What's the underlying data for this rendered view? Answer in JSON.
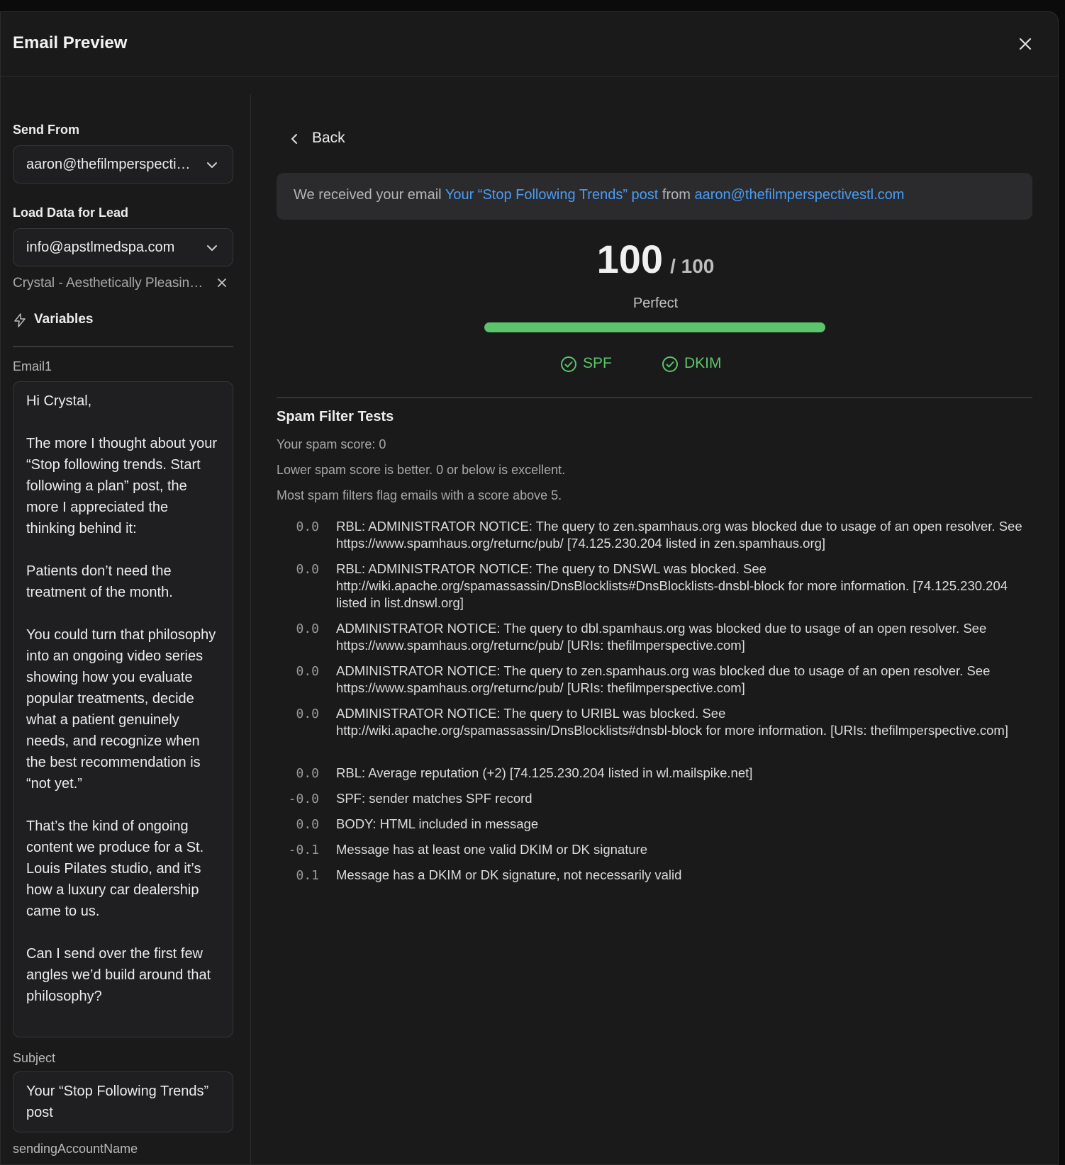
{
  "modal": {
    "title": "Email Preview"
  },
  "left": {
    "send_from_label": "Send From",
    "send_from_value": "aaron@thefilmperspectivestl.com",
    "load_data_label": "Load Data for Lead",
    "lead_email": "info@apstlmedspa.com",
    "lead_name": "Crystal - Aesthetically Pleasing Med Spa",
    "variables_tab": "Variables",
    "email1_label": "Email1",
    "email1_text": "Hi Crystal,\n\nThe more I thought about your “Stop following trends. Start following a plan” post, the more I appreciated the thinking behind it:\n\nPatients don’t need the treatment of the month.\n\nYou could turn that philosophy into an ongoing video series showing how you evaluate popular treatments, decide what a patient genuinely needs, and recognize when the best recommendation is “not yet.”\n\nThat’s the kind of ongoing content we produce for a St. Louis Pilates studio, and it’s how a luxury car dealership came to us.\n\nCan I send over the first few angles we’d build around that philosophy?",
    "subject_label": "Subject",
    "subject_value": "Your “Stop Following Trends” post",
    "sending_account_label": "sendingAccountName"
  },
  "right": {
    "back_label": "Back",
    "receipt_prefix": "We received your email",
    "receipt_subject": "Your “Stop Following Trends” post",
    "receipt_from_word": "from",
    "receipt_sender": "aaron@thefilmperspectivestl.com",
    "score": "100",
    "score_out_of": "/ 100",
    "score_fraction": 1.0,
    "score_label": "Perfect",
    "auth_spf": "SPF",
    "auth_dkim": "DKIM",
    "section_title": "Spam Filter Tests",
    "info_lines": [
      "Your spam score: 0",
      "Lower spam score is better. 0 or below is excellent.",
      "Most spam filters flag emails with a score above 5."
    ],
    "tests": [
      {
        "score": "0.0",
        "desc": "RBL: ADMINISTRATOR NOTICE: The query to zen.spamhaus.org was blocked due to usage of an open resolver. See https://www.spamhaus.org/returnc/pub/ [74.125.230.204 listed in zen.spamhaus.org]"
      },
      {
        "score": "0.0",
        "desc": "RBL: ADMINISTRATOR NOTICE: The query to DNSWL was blocked. See http://wiki.apache.org/spamassassin/DnsBlocklists#DnsBlocklists-dnsbl-block for more information. [74.125.230.204 listed in list.dnswl.org]"
      },
      {
        "score": "0.0",
        "desc": "ADMINISTRATOR NOTICE: The query to dbl.spamhaus.org was blocked due to usage of an open resolver. See https://www.spamhaus.org/returnc/pub/ [URIs: thefilmperspective.com]"
      },
      {
        "score": "0.0",
        "desc": "ADMINISTRATOR NOTICE: The query to zen.spamhaus.org was blocked due to usage of an open resolver. See https://www.spamhaus.org/returnc/pub/ [URIs: thefilmperspective.com]"
      },
      {
        "score": "0.0",
        "desc": "ADMINISTRATOR NOTICE: The query to URIBL was blocked. See http://wiki.apache.org/spamassassin/DnsBlocklists#dnsbl-block for more information. [URIs: thefilmperspective.com]"
      },
      {
        "score": "0.0",
        "desc": "RBL: Average reputation (+2) [74.125.230.204 listed in wl.mailspike.net]"
      },
      {
        "score": "-0.0",
        "desc": "SPF: sender matches SPF record"
      },
      {
        "score": "0.0",
        "desc": "BODY: HTML included in message"
      },
      {
        "score": "-0.1",
        "desc": "Message has at least one valid DKIM or DK signature"
      },
      {
        "score": "0.1",
        "desc": "Message has a DKIM or DK signature, not necessarily valid"
      }
    ]
  },
  "colors": {
    "accent_link": "#4b9cf5",
    "success": "#5cc46a",
    "background": "#1a1a1b"
  },
  "icons": [
    "close-icon",
    "chevron-down-icon",
    "lightning-icon",
    "chevron-left-icon",
    "check-circle-icon"
  ]
}
